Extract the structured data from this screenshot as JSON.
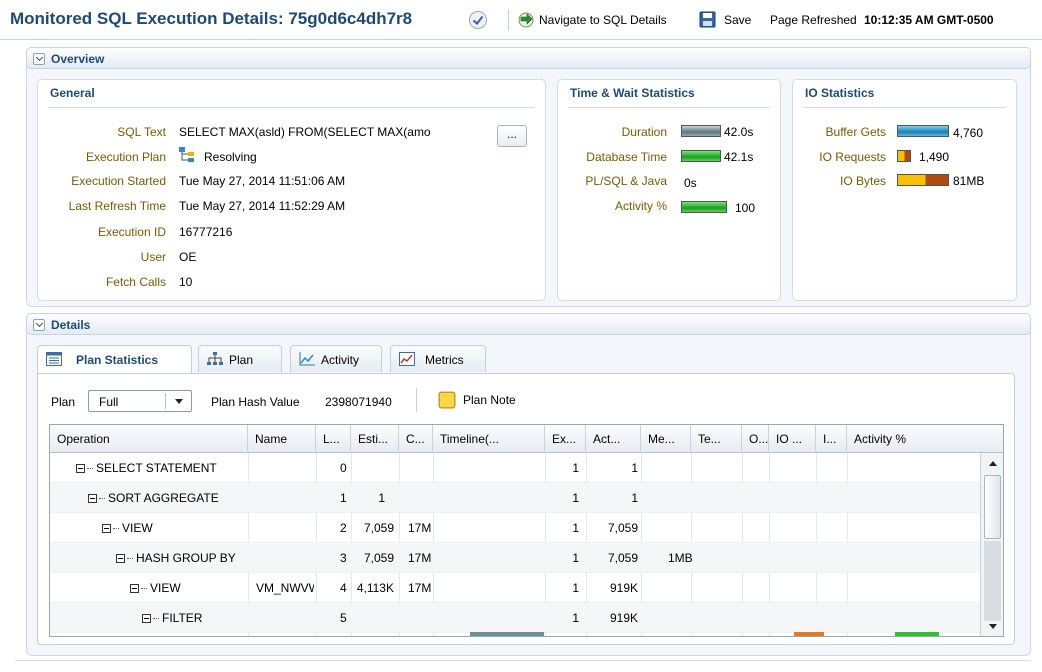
{
  "header": {
    "title": "Monitored SQL Execution Details: 75g0d6c4dh7r8",
    "nav_link": "Navigate to SQL Details",
    "save_label": "Save",
    "refresh_label": "Page Refreshed",
    "refresh_time": "10:12:35 AM GMT-0500"
  },
  "overview": {
    "title": "Overview",
    "general": {
      "title": "General",
      "fields": [
        {
          "label": "SQL Text",
          "value": "SELECT MAX(asld) FROM(SELECT MAX(amo"
        },
        {
          "label": "Execution Plan",
          "value": "Resolving"
        },
        {
          "label": "Execution Started",
          "value": "Tue May 27, 2014 11:51:06 AM"
        },
        {
          "label": "Last Refresh Time",
          "value": "Tue May 27, 2014 11:52:29 AM"
        },
        {
          "label": "Execution ID",
          "value": "16777216"
        },
        {
          "label": "User",
          "value": "OE"
        },
        {
          "label": "Fetch Calls",
          "value": "10"
        }
      ],
      "more_button": "..."
    },
    "time_wait": {
      "title": "Time & Wait Statistics",
      "rows": [
        {
          "label": "Duration",
          "value": "42.0s",
          "fill": 1.0,
          "color": "gray"
        },
        {
          "label": "Database Time",
          "value": "42.1s",
          "fill": 1.0,
          "color": "green"
        },
        {
          "label": "PL/SQL & Java",
          "value": "0s",
          "fill": 0.0,
          "color": "none"
        },
        {
          "label": "Activity %",
          "value": "100",
          "fill": 1.0,
          "color": "green"
        }
      ]
    },
    "io": {
      "title": "IO Statistics",
      "rows": [
        {
          "label": "Buffer Gets",
          "value": "4,760",
          "fill": 1.0,
          "color": "blue"
        },
        {
          "label": "IO Requests",
          "value": "1,490",
          "fill": 0.2,
          "color": "io"
        },
        {
          "label": "IO Bytes",
          "value": "81MB",
          "fill": 1.0,
          "color": "io"
        }
      ]
    }
  },
  "details": {
    "title": "Details",
    "tabs": [
      {
        "label": "Plan Statistics",
        "icon": "table-icon"
      },
      {
        "label": "Plan",
        "icon": "tree-icon"
      },
      {
        "label": "Activity",
        "icon": "chart-icon"
      },
      {
        "label": "Metrics",
        "icon": "metrics-icon"
      }
    ],
    "plan_label": "Plan",
    "plan_select": "Full",
    "hash_label": "Plan Hash Value",
    "hash_value": "2398071940",
    "plan_note": "Plan Note",
    "columns": [
      "Operation",
      "Name",
      "L...",
      "Esti...",
      "C...",
      "Timeline(...",
      "Ex...",
      "Act...",
      "Me...",
      "Te...",
      "O...",
      "IO ...",
      "I...",
      "Activity %"
    ],
    "rows": [
      {
        "operation": "SELECT STATEMENT",
        "depth": 0,
        "name": "",
        "line": "0",
        "est": "",
        "cost": "",
        "ex": "1",
        "act": "1",
        "mem": ""
      },
      {
        "operation": "SORT AGGREGATE",
        "depth": 1,
        "name": "",
        "line": "1",
        "est": "1",
        "cost": "",
        "ex": "1",
        "act": "1",
        "mem": ""
      },
      {
        "operation": "VIEW",
        "depth": 2,
        "name": "",
        "line": "2",
        "est": "7,059",
        "cost": "17M",
        "ex": "1",
        "act": "7,059",
        "mem": ""
      },
      {
        "operation": "HASH GROUP BY",
        "depth": 3,
        "name": "",
        "line": "3",
        "est": "7,059",
        "cost": "17M",
        "ex": "1",
        "act": "7,059",
        "mem": "1MB"
      },
      {
        "operation": "VIEW",
        "depth": 4,
        "name": "VM_NWVW",
        "line": "4",
        "est": "4,113K",
        "cost": "17M",
        "ex": "1",
        "act": "919K",
        "mem": ""
      },
      {
        "operation": "FILTER",
        "depth": 5,
        "name": "",
        "line": "5",
        "est": "",
        "cost": "",
        "ex": "1",
        "act": "919K",
        "mem": ""
      }
    ]
  }
}
